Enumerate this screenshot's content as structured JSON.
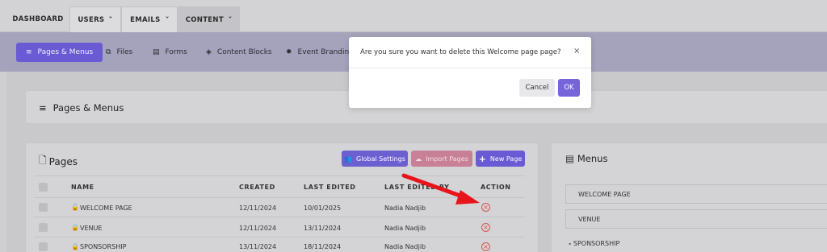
{
  "topnav": {
    "dashboard": "DASHBOARD",
    "users": "USERS",
    "emails": "EMAILS",
    "content": "CONTENT"
  },
  "subnav": {
    "pages_menus": "Pages & Menus",
    "files": "Files",
    "forms": "Forms",
    "content_blocks": "Content Blocks",
    "event_branding": "Event Branding"
  },
  "section_title": "Pages & Menus",
  "pages": {
    "title": "Pages",
    "global_settings": "Global Settings",
    "import_pages": "Import Pages",
    "new_page": "New Page",
    "columns": [
      "NAME",
      "CREATED",
      "LAST EDITED",
      "LAST EDITED BY",
      "ACTION"
    ],
    "rows": [
      {
        "name": "WELCOME PAGE",
        "created": "12/11/2024",
        "last_edited": "10/01/2025",
        "edited_by": "Nadia Nadjib",
        "locked": false
      },
      {
        "name": "VENUE",
        "created": "12/11/2024",
        "last_edited": "13/11/2024",
        "edited_by": "Nadia Nadjib",
        "locked": true
      },
      {
        "name": "SPONSORSHIP",
        "created": "13/11/2024",
        "last_edited": "18/11/2024",
        "edited_by": "Nadia Nadjib",
        "locked": true
      }
    ]
  },
  "menus": {
    "title": "Menus",
    "items": [
      "WELCOME PAGE",
      "VENUE",
      "SPONSORSHIP"
    ]
  },
  "modal": {
    "question": "Are you sure you want to delete this Welcome page page?",
    "cancel": "Cancel",
    "ok": "OK"
  },
  "colors": {
    "accent": "#6a5ad3",
    "import": "#c78095",
    "danger": "#d9534f",
    "arrow": "#e8141b"
  }
}
